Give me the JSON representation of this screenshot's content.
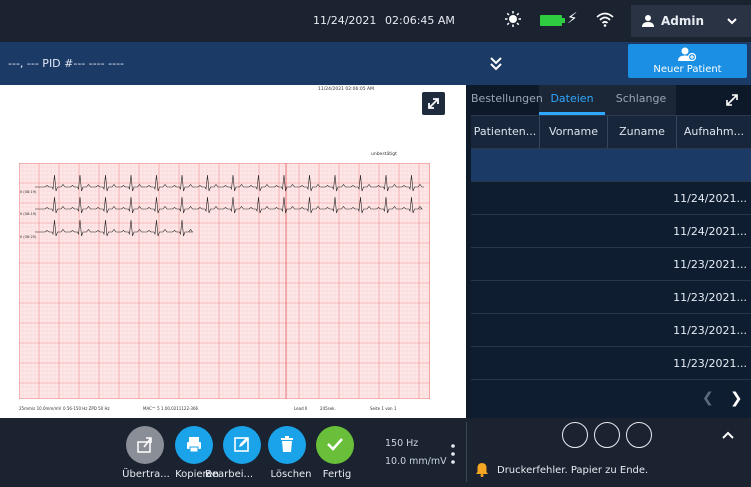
{
  "topbar": {
    "date": "11/24/2021",
    "time": "02:06:45 AM",
    "user": "Admin",
    "icons": [
      "brightness-icon",
      "battery-icon",
      "charging-icon",
      "wifi-icon",
      "user-icon",
      "chevron-down-icon"
    ],
    "battery_color": "#2ecc40"
  },
  "subbar": {
    "patient_info": "---, ---  PID #--- ---- ----",
    "new_patient_label": "Neuer Patient",
    "accent": "#1a8fe3"
  },
  "preview": {
    "header_date": "11/24/2021 02:06:05 AM",
    "unconfirmed": "unbestätigt",
    "lead_labels": [
      "II (08:19)",
      "II (08:19)",
      "II (08:25)"
    ],
    "footer": {
      "speed": "25mm/s  10.0mm/mV",
      "filter": "0.56-150 Hz  ZPD   50 Hz",
      "device": "MAC™ 5 1.00.0211122-366",
      "lead": "Lead II",
      "duration": "245sek.",
      "page": "Seite 1 von 1"
    },
    "grid_color": "#f4a9a9"
  },
  "tabs": [
    {
      "label": "Bestellungen",
      "active": false
    },
    {
      "label": "Dateien",
      "active": true
    },
    {
      "label": "Schlange",
      "active": false
    }
  ],
  "table": {
    "columns": [
      "Patienten...",
      "Vorname",
      "Zuname",
      "Aufnahm..."
    ],
    "rows": [
      {
        "date": "",
        "selected": true
      },
      {
        "date": "11/24/2021...",
        "selected": false
      },
      {
        "date": "11/24/2021...",
        "selected": false
      },
      {
        "date": "11/23/2021...",
        "selected": false
      },
      {
        "date": "11/23/2021...",
        "selected": false
      },
      {
        "date": "11/23/2021...",
        "selected": false
      },
      {
        "date": "11/23/2021...",
        "selected": false
      }
    ]
  },
  "actions": [
    {
      "label": "Übertra...",
      "icon": "upload-icon",
      "color": "#8a8f97"
    },
    {
      "label": "Kopieren",
      "icon": "printer-icon",
      "color": "#1aa3e8"
    },
    {
      "label": "Bearbei...",
      "icon": "edit-icon",
      "color": "#1aa3e8"
    },
    {
      "label": "Löschen",
      "icon": "trash-icon",
      "color": "#1aa3e8"
    },
    {
      "label": "Fertig",
      "icon": "check-icon",
      "color": "#6abf3a"
    }
  ],
  "settings": {
    "frequency": "150 Hz",
    "gain": "10.0 mm/mV"
  },
  "status": {
    "message": "Druckerfehler. Papier zu Ende.",
    "bell_color": "#f5a623"
  }
}
